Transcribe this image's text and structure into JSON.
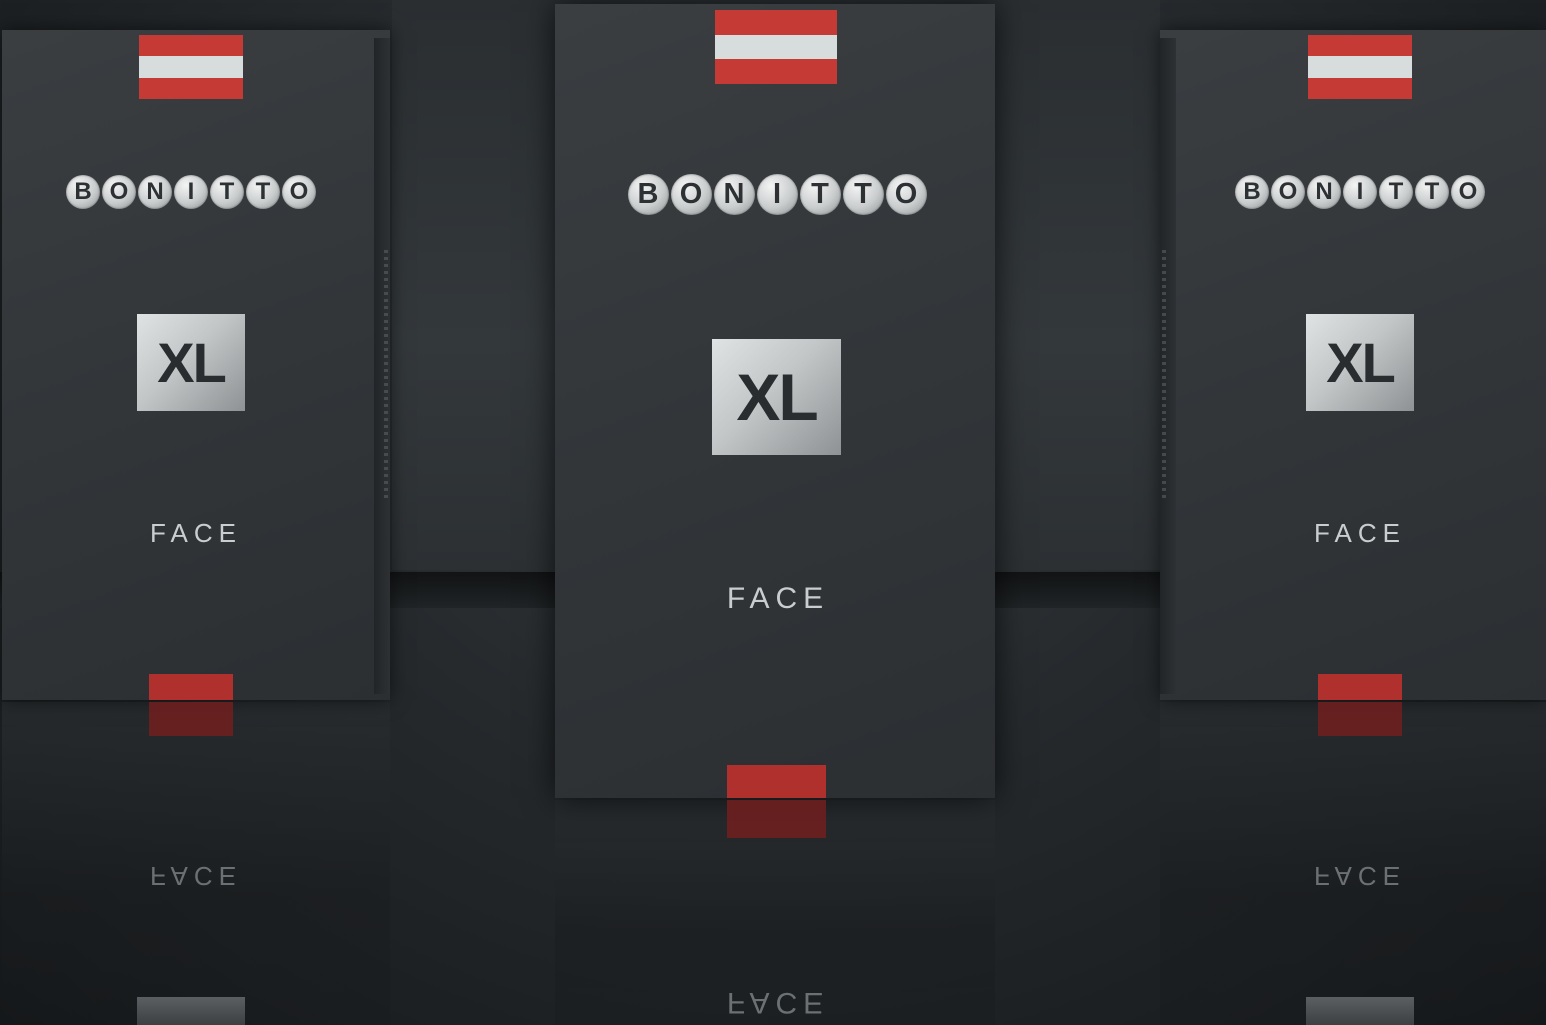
{
  "scene": {
    "colors": {
      "background": "#1b1f21",
      "box": "#33373a",
      "flag_red": "#c63a36",
      "flag_white": "#d7dcdd",
      "tab_red": "#b0302e"
    }
  },
  "product": {
    "brand_letters": [
      "B",
      "O",
      "N",
      "I",
      "T",
      "T",
      "O"
    ],
    "size_label": "XL",
    "type_label": "FACE"
  },
  "boxes": [
    {
      "brand": "BONITTO",
      "size": "XL",
      "type": "FACE"
    },
    {
      "brand": "BONITTO",
      "size": "XL",
      "type": "FACE"
    },
    {
      "brand": "BONITTO",
      "size": "XL",
      "type": "FACE"
    }
  ]
}
